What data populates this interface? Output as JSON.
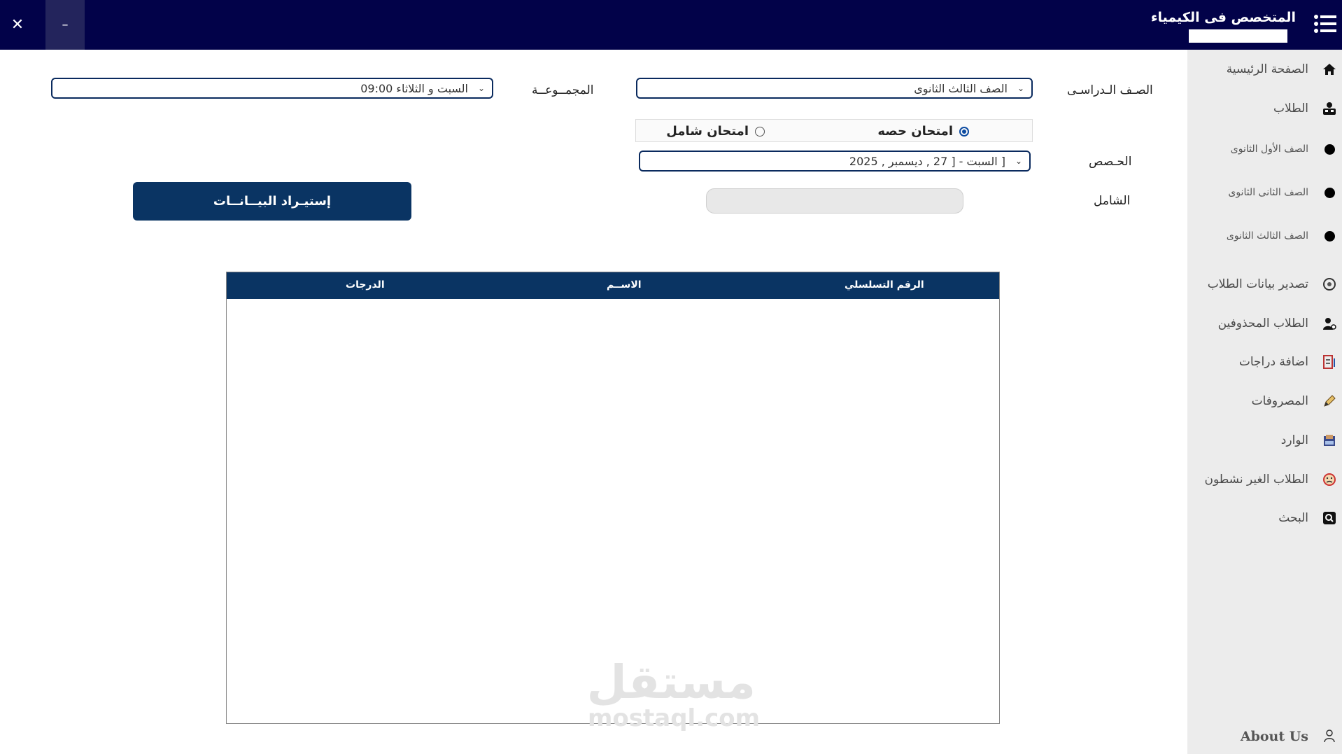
{
  "window": {
    "close_glyph": "✕",
    "minimize_glyph": "–"
  },
  "header": {
    "title": "المتخصص فى الكيمياء",
    "subtitle_field_value": "",
    "menu_icon": "menu-icon"
  },
  "sidebar": {
    "items": [
      {
        "label": "الصفحة الرئيسية",
        "icon": "home-icon"
      },
      {
        "label": "الطلاب",
        "icon": "students-icon"
      },
      {
        "label": "الصف الأول الثانوى",
        "icon": "bullet-icon"
      },
      {
        "label": "الصف الثانى الثانوى",
        "icon": "bullet-icon"
      },
      {
        "label": "الصف الثالث الثانوى",
        "icon": "bullet-icon"
      },
      {
        "label": "تصدير بيانات الطلاب",
        "icon": "export-icon"
      },
      {
        "label": "الطلاب المحذوفين",
        "icon": "deleted-user-icon"
      },
      {
        "label": "اضافة دراجات",
        "icon": "add-grades-icon"
      },
      {
        "label": "المصروفات",
        "icon": "pencil-icon"
      },
      {
        "label": "الوارد",
        "icon": "inbox-icon"
      },
      {
        "label": "الطلاب الغير نشطون",
        "icon": "inactive-icon"
      },
      {
        "label": "البحث",
        "icon": "search-icon"
      }
    ],
    "about": {
      "label": "About Us",
      "icon": "about-icon"
    }
  },
  "form": {
    "grade_label": "الصـف الـدراسـى",
    "grade_value": "الصف الثالث الثانوى",
    "group_label": "المجمــوعــة",
    "group_value": "السبت و الثلاثاء  09:00",
    "exam_type_options": [
      {
        "label": "امتحان حصه",
        "selected": true
      },
      {
        "label": "امتحان شامل",
        "selected": false
      }
    ],
    "sessions_label": "الحـصص",
    "sessions_value": "[ السبت - [ 27 , ديسمبر , 2025",
    "comprehensive_label": "الشامل",
    "comprehensive_value": "",
    "import_button": "إستيـراد البيــانــات"
  },
  "table": {
    "columns": [
      "الرقم التسلسلي",
      "الاســم",
      "الدرجات"
    ],
    "rows": []
  },
  "watermark": {
    "arabic": "مستقل",
    "latin": "mostaql.com"
  },
  "colors": {
    "topbar": "#020249",
    "accent": "#0a3463",
    "sidebar": "#ececec"
  }
}
